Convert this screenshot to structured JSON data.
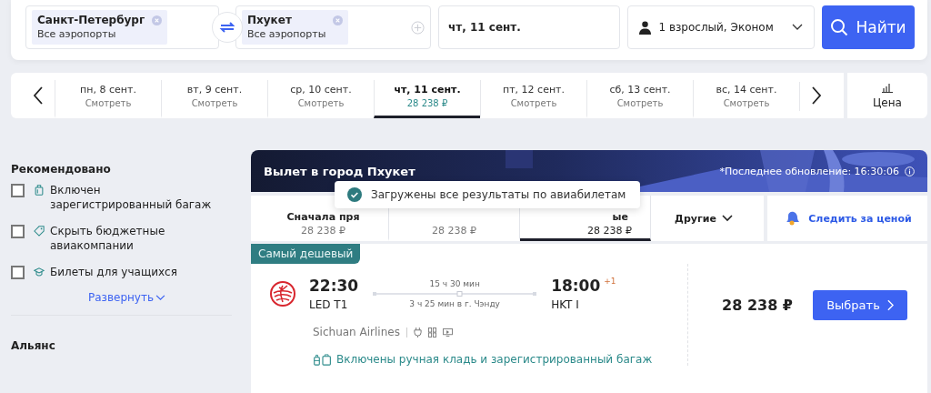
{
  "search": {
    "from": {
      "city": "Санкт-Петербург",
      "airports": "Все аэропорты"
    },
    "to": {
      "city": "Пхукет",
      "airports": "Все аэропорты"
    },
    "date": "чт, 11 сент.",
    "passengers": "1 взрослый, Эконом",
    "button": "Найти"
  },
  "dates": [
    {
      "day": "пн, 8 сент.",
      "sub": "Смотреть",
      "selected": false
    },
    {
      "day": "вт, 9 сент.",
      "sub": "Смотреть",
      "selected": false
    },
    {
      "day": "ср, 10 сент.",
      "sub": "Смотреть",
      "selected": false
    },
    {
      "day": "чт, 11 сент.",
      "sub": "28 238 ₽",
      "selected": true
    },
    {
      "day": "пт, 12 сент.",
      "sub": "Смотреть",
      "selected": false
    },
    {
      "day": "сб, 13 сент.",
      "sub": "Смотреть",
      "selected": false
    },
    {
      "day": "вс, 14 сент.",
      "sub": "Смотреть",
      "selected": false
    }
  ],
  "price_view": "Цена",
  "filters": {
    "title": "Рекомендовано",
    "items": [
      {
        "kind": "baggage",
        "label": "Включен зарегистрированный багаж",
        "checked": false
      },
      {
        "kind": "tag",
        "label": "Скрыть бюджетные авиакомпании",
        "checked": false
      },
      {
        "kind": "student",
        "label": "Билеты для учащихся",
        "checked": false
      }
    ],
    "expand": "Развернуть"
  },
  "alliance_title": "Альянс",
  "results": {
    "title": "Вылет в город Пхукет",
    "updated": "*Последнее обновление: 16:30:06",
    "sort_tabs": [
      {
        "label": "Сначала пря",
        "price": "28 238 ₽",
        "selected": false
      },
      {
        "price": "28 238 ₽",
        "selected": false
      },
      {
        "label": "ые",
        "price": "28 238 ₽",
        "selected": true
      }
    ],
    "other": "Другие",
    "track": "Следить за ценой",
    "toast": "Загружены все результаты по авиабилетам"
  },
  "flight": {
    "badge": "Самый дешевый",
    "depart_time": "22:30",
    "depart_airport": "LED T1",
    "duration": "15 ч 30 мин",
    "stop": "3 ч 25 мин в г. Чэнду",
    "arrive_time": "18:00",
    "day_offset": "+1",
    "arrive_airport": "HKT I",
    "airline": "Sichuan Airlines",
    "baggage_note": "Включены ручная кладь и зарегистрированный багаж",
    "price": "28 238 ₽",
    "select": "Выбрать"
  }
}
